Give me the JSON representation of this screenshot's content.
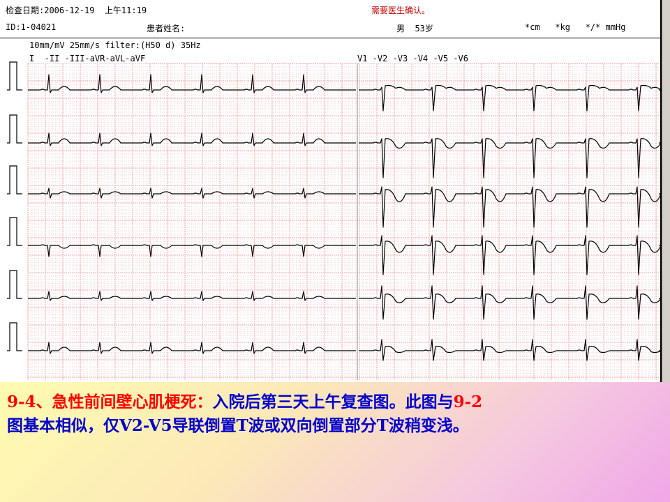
{
  "header": {
    "exam_date": "检查日期:2006-12-19  上午11:19",
    "alert": "需要医生确认。",
    "id": "ID:1-04021",
    "patient_name_label": "患者姓名:",
    "sex_age": "男  53岁",
    "units": "*cm   *kg   */* mmHg"
  },
  "ecg": {
    "settings": "10mm/mV 25mm/s filter:(H50 d) 35Hz",
    "left_leads": "I  -II -III-aVR-aVL-aVF",
    "right_leads": "V1 -V2 -V3 -V4 -V5 -V6",
    "grid_color": "#e88a8a",
    "trace_color": "#000000"
  },
  "caption": {
    "title": "9-4、急性前间壁心肌梗死：",
    "body": "入院后第三天上午复查图。此图与",
    "ref": "9-2",
    "body2": "图基本相似，仅V2-V5导联倒置T波或双向倒置部分T波稍变浅。"
  }
}
